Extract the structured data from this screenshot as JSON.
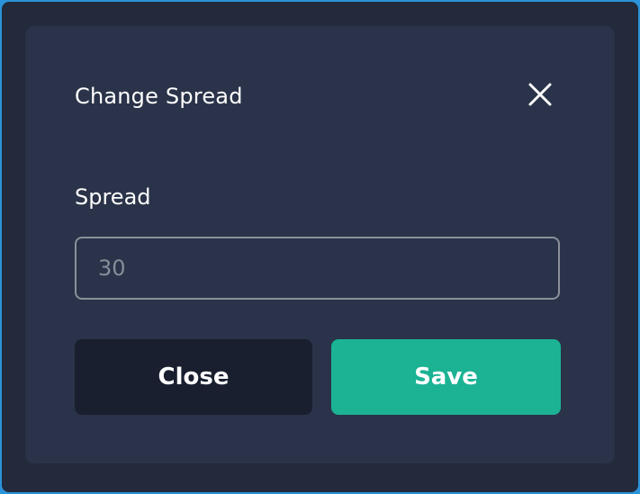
{
  "dialog": {
    "title": "Change Spread",
    "close_icon": "close-icon",
    "field": {
      "label": "Spread",
      "value": "",
      "placeholder": "30"
    },
    "buttons": {
      "close_label": "Close",
      "save_label": "Save"
    }
  },
  "colors": {
    "window_border": "#2b93d9",
    "window_bg": "#222a3b",
    "dialog_bg": "#2a3349",
    "close_button_bg": "#191f2e",
    "save_button_bg": "#1bb394",
    "input_border": "#8a909b"
  }
}
